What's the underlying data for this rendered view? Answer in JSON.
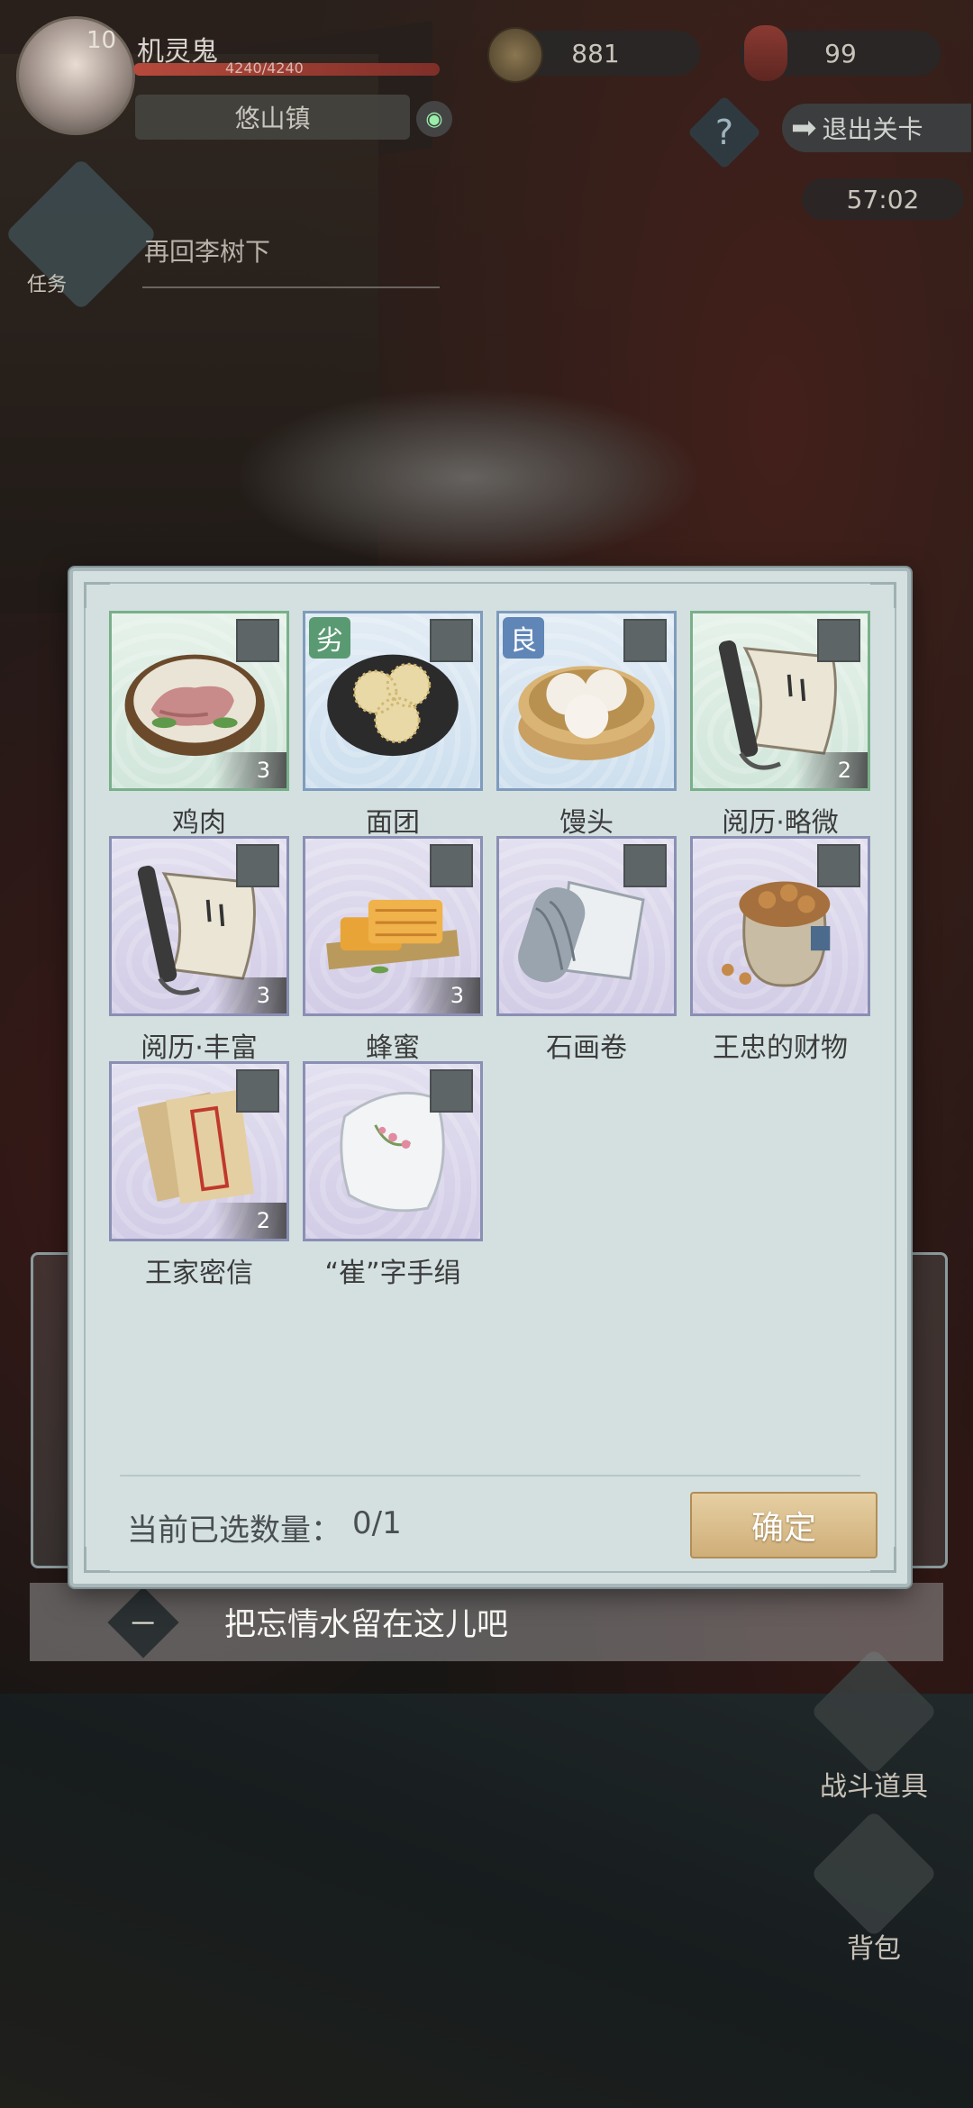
{
  "hud": {
    "level": "10",
    "player_name": "机灵鬼",
    "hp_text": "4240/4240",
    "hp_fraction": 1.0,
    "location": "悠山镇",
    "coins": "881",
    "gourds": "99",
    "exit_label": "退出关卡",
    "timer": "57:02",
    "quest_label": "任务",
    "quest_text": "再回李树下"
  },
  "side_buttons": {
    "battle_items": "战斗道具",
    "backpack": "背包"
  },
  "dialog": {
    "items": [
      {
        "name": "鸡肉",
        "count": "3",
        "quality": "",
        "frame": "green"
      },
      {
        "name": "面团",
        "count": "",
        "quality": "劣",
        "frame": "blue"
      },
      {
        "name": "馒头",
        "count": "",
        "quality": "良",
        "frame": "blue"
      },
      {
        "name": "阅历·略微",
        "count": "2",
        "quality": "",
        "frame": "green"
      },
      {
        "name": "阅历·丰富",
        "count": "3",
        "quality": "",
        "frame": "purple"
      },
      {
        "name": "蜂蜜",
        "count": "3",
        "quality": "",
        "frame": "purple"
      },
      {
        "name": "石画卷",
        "count": "",
        "quality": "",
        "frame": "purple"
      },
      {
        "name": "王忠的财物",
        "count": "",
        "quality": "",
        "frame": "purple"
      },
      {
        "name": "王家密信",
        "count": "2",
        "quality": "",
        "frame": "purple"
      },
      {
        "name": "“崔”字手绢",
        "count": "",
        "quality": "",
        "frame": "purple"
      }
    ],
    "selected_label": "当前已选数量：",
    "selected_count": "0/1",
    "confirm_label": "确定"
  },
  "dialogue": {
    "marker": "一",
    "text": "把忘情水留在这儿吧"
  },
  "colors": {
    "dialog_bg": "#d4e0e0",
    "frame_green": "#79b08a",
    "frame_blue": "#7e9cbc",
    "frame_purple": "#8a8fb4",
    "confirm_gold": "#cfae78"
  }
}
